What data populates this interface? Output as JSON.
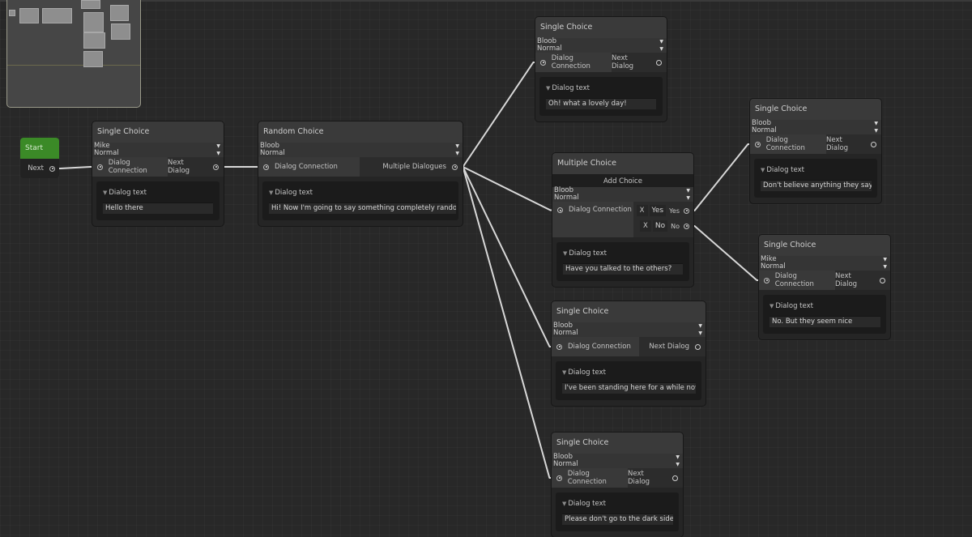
{
  "canvas": {
    "edge_color": "#d8d8d8",
    "start_color": "#3b8a27"
  },
  "minimap": {
    "label": "minimap"
  },
  "start_node": {
    "title": "Start",
    "port_label": "Next"
  },
  "nodes": [
    {
      "id": "n1",
      "type": "Single Choice",
      "title": "Single Choice",
      "speaker": "Mike",
      "mood": "Normal",
      "input_label": "Dialog Connection",
      "output_label": "Next Dialog",
      "output_connected": true,
      "foldout_label": "Dialog text",
      "text": "Hello there"
    },
    {
      "id": "n2",
      "type": "Random Choice",
      "title": "Random Choice",
      "speaker": "Bloob",
      "mood": "Normal",
      "input_label": "Dialog Connection",
      "output_label": "Multiple Dialogues",
      "output_connected": true,
      "foldout_label": "Dialog text",
      "text": "Hi! Now I'm going to say something completely random:"
    },
    {
      "id": "n3",
      "type": "Single Choice",
      "title": "Single Choice",
      "speaker": "Bloob",
      "mood": "Normal",
      "input_label": "Dialog Connection",
      "output_label": "Next Dialog",
      "output_connected": false,
      "foldout_label": "Dialog text",
      "text": "Oh! what a lovely day!"
    },
    {
      "id": "n4",
      "type": "Multiple Choice",
      "title": "Multiple Choice",
      "add_choice_label": "Add Choice",
      "speaker": "Bloob",
      "mood": "Normal",
      "input_label": "Dialog Connection",
      "choices": [
        {
          "remove_label": "X",
          "value": "Yes",
          "port_label": "Yes"
        },
        {
          "remove_label": "X",
          "value": "No",
          "port_label": "No"
        }
      ],
      "foldout_label": "Dialog text",
      "text": "Have you talked to the others?"
    },
    {
      "id": "n5",
      "type": "Single Choice",
      "title": "Single Choice",
      "speaker": "Bloob",
      "mood": "Normal",
      "input_label": "Dialog Connection",
      "output_label": "Next Dialog",
      "output_connected": false,
      "foldout_label": "Dialog text",
      "text": "I've been standing here for a while now."
    },
    {
      "id": "n6",
      "type": "Single Choice",
      "title": "Single Choice",
      "speaker": "Bloob",
      "mood": "Normal",
      "input_label": "Dialog Connection",
      "output_label": "Next Dialog",
      "output_connected": false,
      "foldout_label": "Dialog text",
      "text": "Please don't go to the dark side"
    },
    {
      "id": "n7",
      "type": "Single Choice",
      "title": "Single Choice",
      "speaker": "Bloob",
      "mood": "Normal",
      "input_label": "Dialog Connection",
      "output_label": "Next Dialog",
      "output_connected": false,
      "foldout_label": "Dialog text",
      "text": "Don't believe anything they say!"
    },
    {
      "id": "n8",
      "type": "Single Choice",
      "title": "Single Choice",
      "speaker": "Mike",
      "mood": "Normal",
      "input_label": "Dialog Connection",
      "output_label": "Next Dialog",
      "output_connected": false,
      "foldout_label": "Dialog text",
      "text": "No. But they seem nice"
    }
  ],
  "connections": [
    {
      "from": "start.Next",
      "to": "n1.Dialog Connection"
    },
    {
      "from": "n1.Next Dialog",
      "to": "n2.Dialog Connection"
    },
    {
      "from": "n2.Multiple Dialogues",
      "to": "n3.Dialog Connection"
    },
    {
      "from": "n2.Multiple Dialogues",
      "to": "n4.Dialog Connection"
    },
    {
      "from": "n2.Multiple Dialogues",
      "to": "n5.Dialog Connection"
    },
    {
      "from": "n2.Multiple Dialogues",
      "to": "n6.Dialog Connection"
    },
    {
      "from": "n4.Yes",
      "to": "n7.Dialog Connection"
    },
    {
      "from": "n4.No",
      "to": "n8.Dialog Connection"
    }
  ]
}
